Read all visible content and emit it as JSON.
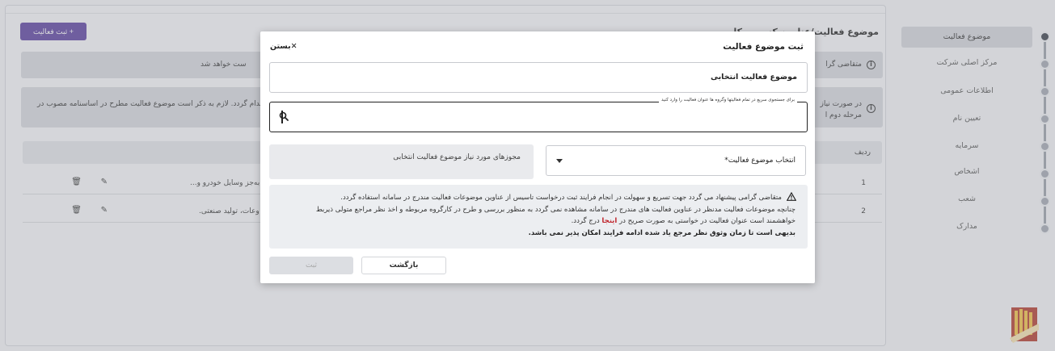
{
  "sidebar": {
    "items": [
      {
        "label": "موضوع فعالیت"
      },
      {
        "label": "مرکز اصلی شرکت"
      },
      {
        "label": "اطلاعات عمومی"
      },
      {
        "label": "تعیین نام"
      },
      {
        "label": "سرمایه"
      },
      {
        "label": "اشخاص"
      },
      {
        "label": "شعب"
      },
      {
        "label": "مدارک"
      }
    ]
  },
  "page": {
    "title": "موضوع فعالیت/عناوین کسب و کار",
    "add_button": "+ ثبت فعالیت",
    "info1": "متقاضی گرا",
    "info1_tail": "ست خواهد شد",
    "info2_a": "در صورت نیاز",
    "info2_b": "مرحله دوم ا",
    "info2_tail": "اقدام گردد.  لازم به ذکر است موضوع فعالیت مطرح در اساسنامه مصوب در",
    "table_header_index": "ردیف",
    "rows": [
      {
        "index": "1",
        "text": "به‌جز وسایل خودرو و..."
      },
      {
        "index": "2",
        "text": "وعات، تولید صنعتی."
      }
    ]
  },
  "modal": {
    "title": "ثبت موضوع فعالیت",
    "close_label": "بستن",
    "selected_label": "موضوع فعالیت انتخابی",
    "search_legend": "برای جستجوی سریع در تمام فعالیتها وگروه ها عنوان فعالیت را وارد کنید",
    "search_value": "",
    "select_label": "انتخاب موضوع فعالیت*",
    "licenses_label": "مجوزهای مورد نیاز موضوع فعالیت انتخابی",
    "note": {
      "line1": "متقاضی گرامی پیشنهاد می گردد جهت تسریع و سهولت در انجام فرایند ثبت درخواست تاسیس از عناوین موضوعات فعالیت مندرج در سامانه استفاده گردد.",
      "line2": "چنانچه موضوعات فعالیت مدنظر در عناوین فعالیت های مندرج در سامانه مشاهده نمی گردد به منظور بررسی و طرح در کارگروه مربوطه و اخذ نظر مراجع متولی ذیربط",
      "line3_a": "خواهشمند است عنوان فعالیت در خواستی به صورت صریح در",
      "line3_link": "اینجا",
      "line3_b": "درج گردد.",
      "line4": "بدیهی است تا زمان وثوق نظر مرجع یاد شده ادامه فرایند امکان پذیر نمی باشد."
    },
    "back_button": "بازگشت",
    "submit_button": "ثبت"
  }
}
